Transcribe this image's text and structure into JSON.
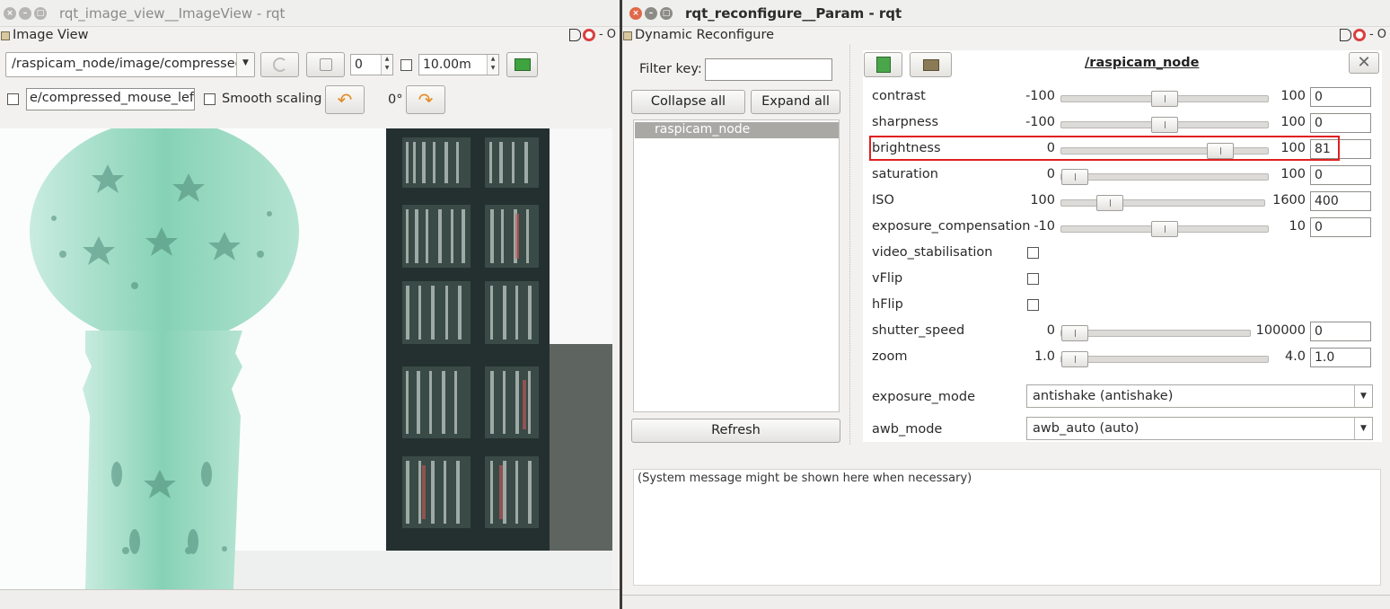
{
  "left_window": {
    "title": "rqt_image_view__ImageView - rqt",
    "dock_title": "Image View",
    "dock_controls": "- O",
    "topic_selected": "/raspicam_node/image/compressed",
    "spin_value": "0",
    "interval_value": "10.00m",
    "mouse_topic": "e/compressed_mouse_left",
    "smooth_scaling_label": "Smooth scaling",
    "rotation_label": "0°"
  },
  "right_window": {
    "title": "rqt_reconfigure__Param - rqt",
    "dock_title": "Dynamic Reconfigure",
    "dock_controls": "- O",
    "filter_label": "Filter key:",
    "filter_value": "",
    "collapse_all_label": "Collapse all",
    "expand_all_label": "Expand all",
    "tree_items": [
      "raspicam_node"
    ],
    "refresh_label": "Refresh",
    "node_name": "/raspicam_node",
    "params": [
      {
        "name": "contrast",
        "type": "slider",
        "min": "-100",
        "max": "100",
        "value": "0",
        "fraction": 0.5
      },
      {
        "name": "sharpness",
        "type": "slider",
        "min": "-100",
        "max": "100",
        "value": "0",
        "fraction": 0.5
      },
      {
        "name": "brightness",
        "type": "slider",
        "min": "0",
        "max": "100",
        "value": "81",
        "fraction": 0.81,
        "highlighted": true
      },
      {
        "name": "saturation",
        "type": "slider",
        "min": "0",
        "max": "100",
        "value": "0",
        "fraction": 0.0
      },
      {
        "name": "ISO",
        "type": "slider",
        "min": "100",
        "max": "1600",
        "value": "400",
        "fraction": 0.2
      },
      {
        "name": "exposure_compensation",
        "type": "slider",
        "min": "-10",
        "max": "10",
        "value": "0",
        "fraction": 0.5
      },
      {
        "name": "video_stabilisation",
        "type": "checkbox",
        "checked": false
      },
      {
        "name": "vFlip",
        "type": "checkbox",
        "checked": false
      },
      {
        "name": "hFlip",
        "type": "checkbox",
        "checked": false
      },
      {
        "name": "shutter_speed",
        "type": "slider",
        "min": "0",
        "max": "100000",
        "value": "0",
        "fraction": 0.0
      },
      {
        "name": "zoom",
        "type": "slider",
        "min": "1.0",
        "max": "4.0",
        "value": "1.0",
        "fraction": 0.0
      },
      {
        "name": "exposure_mode",
        "type": "enum",
        "value": "antishake (antishake)"
      },
      {
        "name": "awb_mode",
        "type": "enum",
        "value": "awb_auto (auto)"
      }
    ],
    "system_message": "(System message might be shown here when necessary)"
  },
  "colors": {
    "highlight_box": "#e02020",
    "selected_item": "#a9a8a5",
    "accent_orange": "#e58a1f"
  }
}
